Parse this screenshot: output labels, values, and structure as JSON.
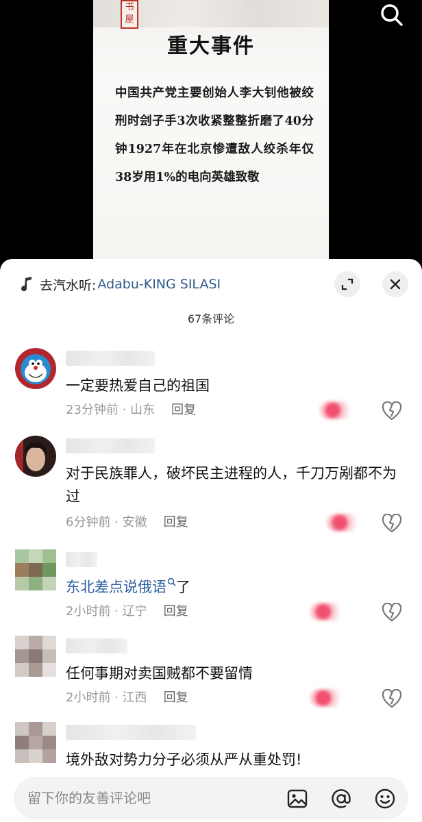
{
  "video": {
    "seal_text": "书屋",
    "title": "重大事件",
    "body": "中国共产党主要创始人李大钊他被绞刑时刽子手3次收紧整整折磨了40分钟1927年在北京惨遭敌人绞杀年仅38岁用1%的电向英雄致敬"
  },
  "sheet": {
    "music_prefix": "去汽水听:",
    "music_song": "Adabu-KING SILASI",
    "comment_count": "67条评论"
  },
  "comments": [
    {
      "text": "一定要热爱自己的祖国",
      "time_location": "23分钟前 · 山东",
      "reply": "回复"
    },
    {
      "text": "对于民族罪人，破坏民主进程的人，千刀万剐都不为过",
      "time_location": "6分钟前 · 安徽",
      "reply": "回复"
    },
    {
      "text_link": "东北差点说俄语",
      "text_suffix": "了",
      "time_location": "2小时前 · 辽宁",
      "reply": "回复"
    },
    {
      "text": "任何事期对卖国贼都不要留情",
      "time_location": "2小时前 · 江西",
      "reply": "回复"
    },
    {
      "text": "境外敌对势力分子必须从严从重处罚!"
    }
  ],
  "input": {
    "placeholder": "留下你的友善评论吧"
  },
  "colors": {
    "accent_link": "#2b5fa0",
    "music_link": "#2e5a8a",
    "like_red": "#f0506e"
  },
  "icons": [
    "search-icon",
    "music-note-icon",
    "expand-icon",
    "close-icon",
    "search-suggest-icon",
    "dislike-heart-icon",
    "image-icon",
    "at-icon",
    "emoji-icon"
  ]
}
